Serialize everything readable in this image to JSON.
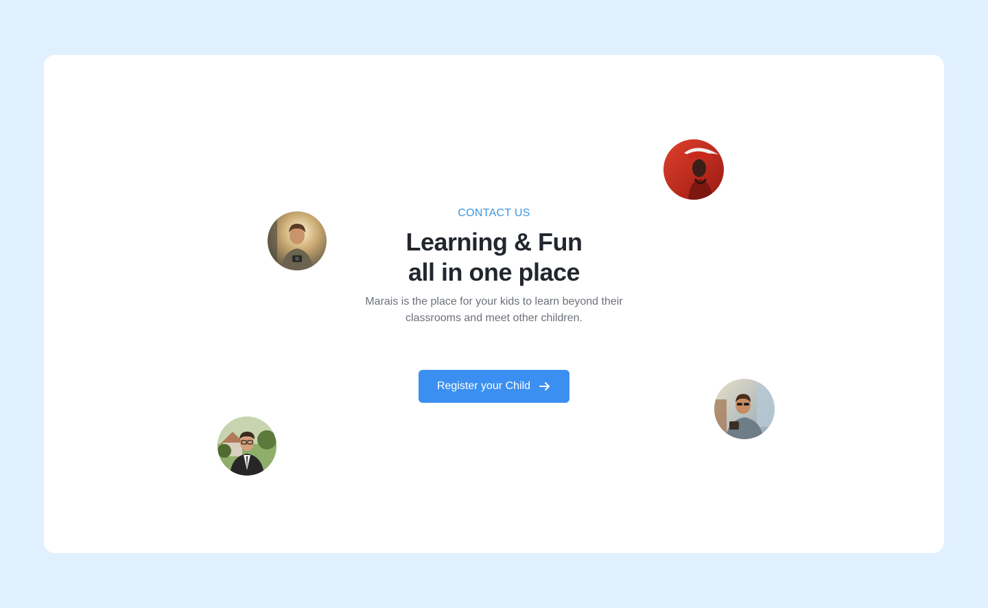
{
  "hero": {
    "eyebrow": "CONTACT US",
    "title_line1": "Learning & Fun",
    "title_line2": "all in one place",
    "subtitle": "Marais is the place for your kids to learn beyond their classrooms and meet other children.",
    "cta_label": "Register your Child",
    "cta_icon": "arrow-right-icon"
  },
  "avatars": [
    {
      "name": "avatar-photographer"
    },
    {
      "name": "avatar-red-hat"
    },
    {
      "name": "avatar-businessman"
    },
    {
      "name": "avatar-sunglasses-man"
    }
  ],
  "colors": {
    "page_background": "#e0f0fe",
    "card_background": "#ffffff",
    "accent": "#3b8ff0",
    "eyebrow": "#3d95e0",
    "heading": "#22272e",
    "body_text": "#6b7078"
  }
}
